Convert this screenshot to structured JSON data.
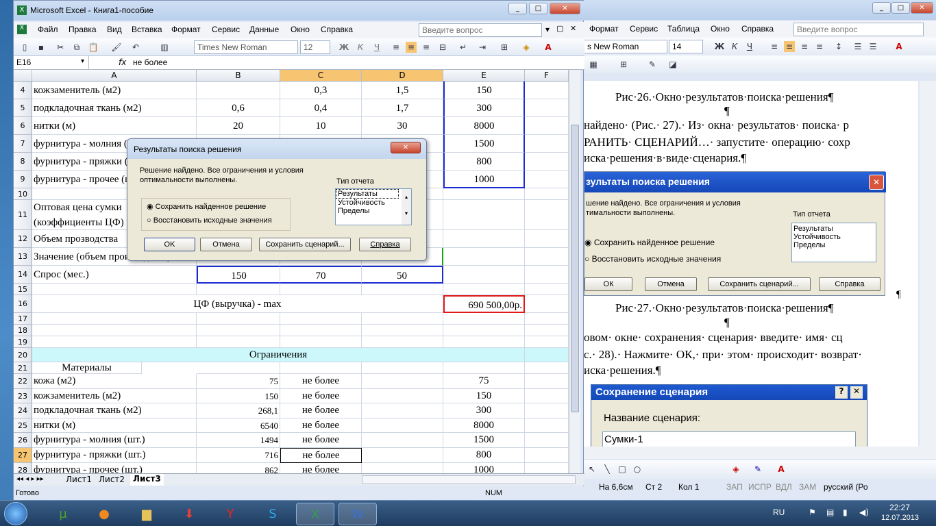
{
  "excel": {
    "title": "Microsoft Excel - Книга1-пособие",
    "menus": [
      "Файл",
      "Правка",
      "Вид",
      "Вставка",
      "Формат",
      "Сервис",
      "Данные",
      "Окно",
      "Справка"
    ],
    "help_placeholder": "Введите вопрос",
    "font_name": "Times New Roman",
    "font_size": "12",
    "bold_label": "Ж",
    "italic_label": "К",
    "underline_label": "Ч",
    "name_box": "E16",
    "fx": "fx",
    "formula": "не более",
    "columns": [
      "A",
      "B",
      "C",
      "D",
      "E",
      "F"
    ],
    "rows": [
      {
        "n": "4",
        "a": "кожзаменитель (м2)",
        "b": "",
        "c": "0,3",
        "d": "1,5",
        "e": "150"
      },
      {
        "n": "5",
        "a": "подкладочная ткань (м2)",
        "b": "0,6",
        "c": "0,4",
        "d": "1,7",
        "e": "300"
      },
      {
        "n": "6",
        "a": "нитки (м)",
        "b": "20",
        "c": "10",
        "d": "30",
        "e": "8000"
      },
      {
        "n": "7",
        "a": "фурнитура - молния (шт.)",
        "b": "",
        "c": "",
        "d": "",
        "e": "1500"
      },
      {
        "n": "8",
        "a": "фурнитура - пряжки (шт.)",
        "b": "",
        "c": "",
        "d": "",
        "e": "800"
      },
      {
        "n": "9",
        "a": "фурнитура - прочее (шт.)",
        "b": "",
        "c": "",
        "d": "",
        "e": "1000"
      },
      {
        "n": "10",
        "a": "",
        "b": "",
        "c": "",
        "d": "",
        "e": ""
      },
      {
        "n": "11",
        "a": "Оптовая цена сумки",
        "a2": "(коэффициенты ЦФ)",
        "b": "",
        "c": "",
        "d": "",
        "e": ""
      },
      {
        "n": "12",
        "a": "Объем прозводства",
        "b": "",
        "c": "",
        "d": "",
        "e": ""
      },
      {
        "n": "13",
        "a": "Значение (объем производства)",
        "b": "",
        "c": "",
        "d": "",
        "e": ""
      },
      {
        "n": "14",
        "a": "Спрос (мес.)",
        "b": "150",
        "c": "70",
        "d": "50",
        "e": ""
      },
      {
        "n": "15",
        "a": "",
        "b": "",
        "c": "",
        "d": "",
        "e": ""
      },
      {
        "n": "16",
        "a": "ЦФ (выручка) - max",
        "b": "",
        "c": "",
        "d": "",
        "e": "690 500,00р."
      },
      {
        "n": "17"
      },
      {
        "n": "18"
      },
      {
        "n": "19"
      },
      {
        "n": "20",
        "a": "Ограничения"
      },
      {
        "n": "21",
        "a": "Материалы"
      },
      {
        "n": "22",
        "a": "кожа (м2)",
        "b": "75",
        "c": "не более",
        "e": "75"
      },
      {
        "n": "23",
        "a": "кожзаменитель (м2)",
        "b": "150",
        "c": "не более",
        "e": "150"
      },
      {
        "n": "24",
        "a": "подкладочная ткань (м2)",
        "b": "268,1",
        "c": "не более",
        "e": "300"
      },
      {
        "n": "25",
        "a": "нитки (м)",
        "b": "6540",
        "c": "не более",
        "e": "8000"
      },
      {
        "n": "26",
        "a": "фурнитура - молния (шт.)",
        "b": "1494",
        "c": "не более",
        "e": "1500"
      },
      {
        "n": "27",
        "a": "фурнитура - пряжки (шт.)",
        "b": "716",
        "c": "не более",
        "e": "800"
      },
      {
        "n": "28",
        "a": "фурнитура - прочее (шт.)",
        "b": "862",
        "c": "не более",
        "e": "1000"
      }
    ],
    "sheets": [
      "Лист1",
      "Лист2",
      "Лист3"
    ],
    "status": "Готово",
    "num": "NUM"
  },
  "dialog": {
    "title": "Результаты поиска решения",
    "message1": "Решение найдено. Все ограничения и условия",
    "message2": "оптимальности выполнены.",
    "report_label": "Тип отчета",
    "reports": [
      "Результаты",
      "Устойчивость",
      "Пределы"
    ],
    "opt_keep": "Сохранить найденное решение",
    "opt_restore": "Восстановить исходные значения",
    "ok": "OK",
    "cancel": "Отмена",
    "save_scenario": "Сохранить сценарий...",
    "help": "Справка"
  },
  "word": {
    "menus": [
      "Формат",
      "Сервис",
      "Таблица",
      "Окно",
      "Справка"
    ],
    "help_placeholder": "Введите вопрос",
    "font_name": "s New Roman",
    "font_size": "14",
    "caption26": "Рис·26.·Окно·результатов·поиска·решения¶",
    "pilcrow": "¶",
    "line1": "найдено· (Рис.· 27).· Из· окна· результатов· поиска· р",
    "line2": "РАНИТЬ· СЦЕНАРИЙ…· запустите· операцию· сохр",
    "line3": "иска·решения·в·виде·сценария.¶",
    "img_title": "зультаты поиска решения",
    "img_msg1": "шение найдено. Все ограничения и условия",
    "img_msg2": "тимальности выполнены.",
    "img_report_label": "Тип отчета",
    "img_reports": [
      "Результаты",
      "Устойчивость",
      "Пределы"
    ],
    "img_opt1": "Сохранить найденное решение",
    "img_opt2": "Восстановить исходные значения",
    "img_ok": "ОК",
    "img_cancel": "Отмена",
    "img_save": "Сохранить сценарий...",
    "img_help": "Справка",
    "caption27": "Рис·27.·Окно·результатов·поиска·решения¶",
    "line4": "овом· окне· сохранения· сценария· введите· имя· сц",
    "line5": "с.· 28).· Нажмите· ОК,· при· этом· происходит· возврат·",
    "line6": "иска·решения.¶",
    "scen_title": "Сохранение сценария",
    "scen_label": "Название сценария:",
    "scen_value": "Сумки-1",
    "status": [
      "На 6,6см",
      "Ст 2",
      "Кол 1",
      "ЗАП",
      "ИСПР",
      "ВДЛ",
      "ЗАМ",
      "русский (Ро"
    ]
  },
  "taskbar": {
    "lang": "RU",
    "time": "22:27",
    "date": "12.07.2013"
  }
}
